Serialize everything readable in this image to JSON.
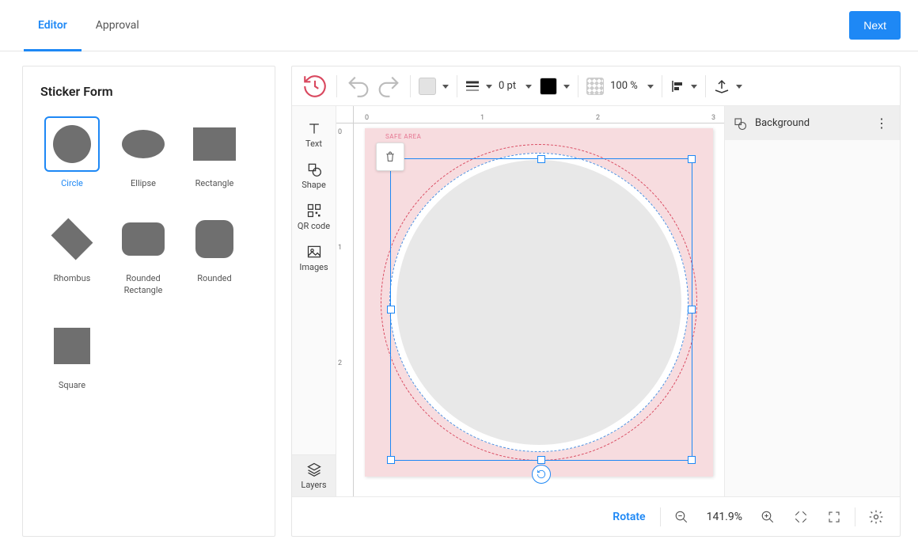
{
  "tabs": {
    "editor": "Editor",
    "approval": "Approval"
  },
  "next": "Next",
  "sidebar": {
    "title": "Sticker Form",
    "shapes": [
      {
        "label": "Circle"
      },
      {
        "label": "Ellipse"
      },
      {
        "label": "Rectangle"
      },
      {
        "label": "Rhombus"
      },
      {
        "label": "Rounded Rectangle"
      },
      {
        "label": "Rounded"
      },
      {
        "label": "Square"
      }
    ]
  },
  "tools": {
    "text": "Text",
    "shape": "Shape",
    "qr": "QR code",
    "images": "Images",
    "layers": "Layers"
  },
  "toolbar": {
    "stroke_pt": "0 pt",
    "opacity": "100 %"
  },
  "ruler_h": [
    "0",
    "1",
    "2",
    "3"
  ],
  "ruler_v": [
    "0",
    "1",
    "2"
  ],
  "safe_area": "SAFE AREA",
  "layers_panel": {
    "background": "Background"
  },
  "bottom": {
    "rotate": "Rotate",
    "zoom": "141.9%"
  },
  "colors": {
    "accent": "#1e88f5",
    "fill_swatch": "#e3e3e3",
    "stroke_swatch": "#000000"
  }
}
